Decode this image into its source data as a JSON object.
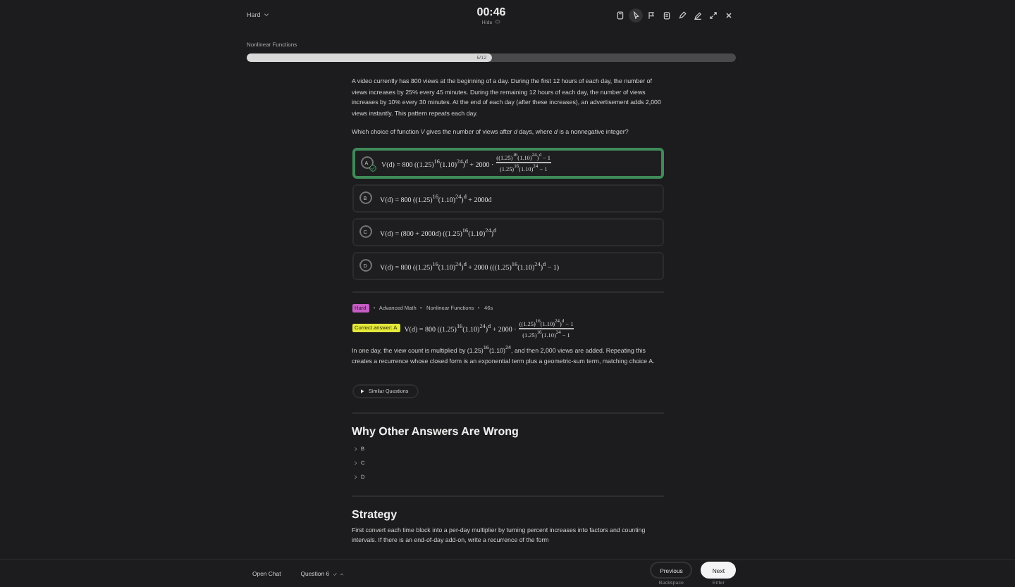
{
  "header": {
    "difficulty": "Hard",
    "timer": "00:46",
    "timer_toggle": "Hide"
  },
  "toolbar": [
    {
      "kind": "calculator",
      "selected": false
    },
    {
      "kind": "cursor",
      "selected": true
    },
    {
      "kind": "flag",
      "selected": false
    },
    {
      "kind": "notes",
      "selected": false
    },
    {
      "kind": "highlighter",
      "selected": false
    },
    {
      "kind": "pen",
      "selected": false
    },
    {
      "kind": "expand",
      "selected": false
    },
    {
      "kind": "close",
      "selected": false
    }
  ],
  "topic": "Nonlinear Functions",
  "progress": {
    "label": "6/12",
    "level": 0.5
  },
  "question": "A video currently has 800 views at the beginning of a day. During the first 12 hours of each day, the number of views increases by 25% every 45 minutes. During the remaining 12 hours of each day, the number of views increases by 10% every 30 minutes. At the end of each day (after these increases), an advertisement adds 2,000 views instantly. This pattern repeats each day.",
  "prompt": "Which choice of function *V* gives the number of views after *d* days, where *d* is a nonnegative integer?",
  "choices": [
    {
      "letter": "A",
      "selected": true,
      "formula": "V(d) = 800 ((1.25)$^{16}$(1.10)$^{24}$)$^{d}$ + 2000 ·",
      "fraction": {
        "num": "((1.25)$^{16}$(1.10)$^{24}$)$^{d}$ − 1",
        "den": "(1.25)$^{16}$(1.10)$^{24}$ − 1"
      }
    },
    {
      "letter": "B",
      "selected": false,
      "formula": "V(d) = 800 ((1.25)$^{16}$(1.10)$^{24}$)$^{d}$ + 2000d"
    },
    {
      "letter": "C",
      "selected": false,
      "formula": "V(d) = (800 + 2000d) ((1.25)$^{16}$(1.10)$^{24}$)$^{d}$"
    },
    {
      "letter": "D",
      "selected": false,
      "formula": "V(d) = 800 ((1.25)$^{16}$(1.10)$^{24}$)$^{d}$ + 2000 (((1.25)$^{16}$(1.10)$^{24}$)$^{d}$ − 1)"
    }
  ],
  "meta": [
    {
      "kind": "difficulty",
      "text": "Hard"
    },
    {
      "kind": "plain",
      "text": "Advanced Math"
    },
    {
      "kind": "plain",
      "text": "Nonlinear Functions"
    },
    {
      "kind": "plain",
      "text": "46s"
    }
  ],
  "answer": {
    "label": "Correct answer: A",
    "formula": "V(d) = 800 ((1.25)$^{16}$(1.10)$^{24}$)$^{d}$ + 2000 ·",
    "fraction": {
      "num": "((1.25)$^{16}$(1.10)$^{24}$)$^{d}$ − 1",
      "den": "(1.25)$^{16}$(1.10)$^{24}$ − 1"
    }
  },
  "explanation": "In one day, the view count is multiplied by (1.25)$^{16}$(1.10)$^{24}$, and then 2,000 views are added. Repeating this creates a recurrence whose closed form is an exponential term plus a geometric-sum term, matching choice A.",
  "similar_button": "Similar Questions",
  "wrong_heading": "Why Other Answers Are Wrong",
  "wrong_items": [
    {
      "label": "B",
      "expanded": false
    },
    {
      "label": "C",
      "expanded": false
    },
    {
      "label": "D",
      "expanded": false
    }
  ],
  "strategy_heading": "Strategy",
  "strategy": "First convert each time block into a per-day multiplier by turning percent increases into factors and counting intervals. If there is an end-of-day add-on, write a recurrence of the form",
  "footer": {
    "chat": "Open Chat",
    "question": "Question 6",
    "previous": "Previous",
    "previous_hint": "Backspace",
    "next": "Next",
    "next_hint": "Enter"
  }
}
